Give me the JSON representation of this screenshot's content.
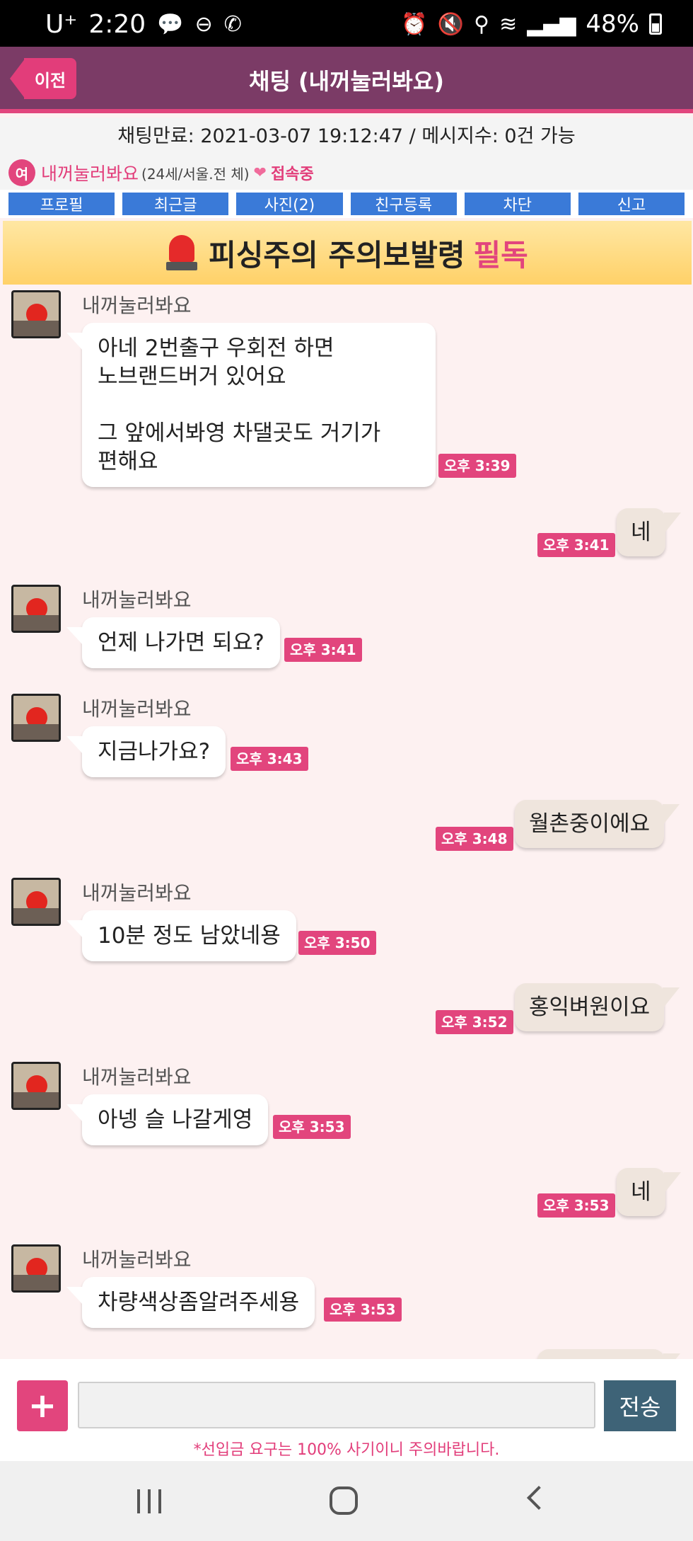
{
  "status_bar": {
    "carrier": "U⁺",
    "time": "2:20",
    "battery": "48%",
    "icons": [
      "chat-bubble-icon",
      "do-not-disturb-icon",
      "whowho-icon",
      "alarm-icon",
      "mute-icon",
      "location-icon",
      "wifi-icon",
      "signal-icon",
      "battery-icon"
    ]
  },
  "header": {
    "back_label": "이전",
    "title": "채팅 (내꺼눌러봐요)"
  },
  "chat_info": {
    "text": "채팅만료: 2021-03-07 19:12:47 / 메시지수: 0건 가능"
  },
  "user": {
    "gender": "여",
    "name": "내꺼눌러봐요",
    "meta": "(24세/서울.전 체)",
    "status": "접속중"
  },
  "actions": [
    "프로필",
    "최근글",
    "사진(2)",
    "친구등록",
    "차단",
    "신고"
  ],
  "banner": {
    "text": "피싱주의 주의보발령",
    "highlight": "필독"
  },
  "messages": [
    {
      "dir": "in",
      "sender": "내꺼눌러봐요",
      "text": "아네 2번출구 우회전 하면\n노브랜드버거 있어요\n\n그 앞에서봐영 차댈곳도 거기가\n편해요",
      "time": "오후 3:39"
    },
    {
      "dir": "out",
      "text": "네",
      "time": "오후 3:41"
    },
    {
      "dir": "in",
      "sender": "내꺼눌러봐요",
      "text": "언제 나가면 되요?",
      "time": "오후 3:41"
    },
    {
      "dir": "in",
      "sender": "내꺼눌러봐요",
      "text": "지금나가요?",
      "time": "오후 3:43"
    },
    {
      "dir": "out",
      "text": "월촌중이에요",
      "time": "오후 3:48"
    },
    {
      "dir": "in",
      "sender": "내꺼눌러봐요",
      "text": "10분 정도 남았네용",
      "time": "오후 3:50"
    },
    {
      "dir": "out",
      "text": "홍익벼원이요",
      "time": "오후 3:52"
    },
    {
      "dir": "in",
      "sender": "내꺼눌러봐요",
      "text": "아넹 슬 나갈게영",
      "time": "오후 3:53"
    },
    {
      "dir": "out",
      "text": "네",
      "time": "오후 3:53"
    },
    {
      "dir": "in",
      "sender": "내꺼눌러봐요",
      "text": "차량색상좀알려주세용",
      "time": "오후 3:53"
    }
  ],
  "composer": {
    "plus": "+",
    "placeholder": "",
    "send_label": "전송",
    "warning": "*선입금 요구는 100% 사기이니 주의바랍니다."
  }
}
